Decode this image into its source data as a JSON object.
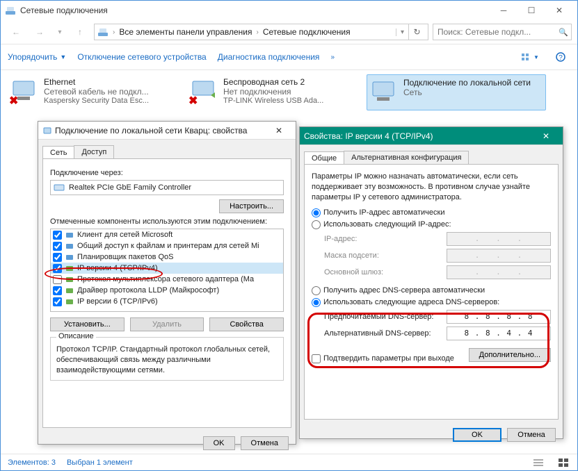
{
  "window": {
    "title": "Сетевые подключения",
    "breadcrumbs": [
      "Все элементы панели управления",
      "Сетевые подключения"
    ],
    "search_placeholder": "Поиск: Сетевые подкл..."
  },
  "toolbar": {
    "organize": "Упорядочить",
    "disable_device": "Отключение сетевого устройства",
    "diagnose": "Диагностика подключения"
  },
  "connections": [
    {
      "name": "Ethernet",
      "status": "Сетевой кабель не подкл...",
      "adapter": "Kaspersky Security Data Esc...",
      "err": true
    },
    {
      "name": "Беспроводная сеть 2",
      "status": "Нет подключения",
      "adapter": "TP-LINK Wireless USB Ada...",
      "err": true
    },
    {
      "name": "Подключение по локальной сети",
      "status": "Сеть",
      "adapter": "",
      "err": false,
      "selected": true
    }
  ],
  "statusbar": {
    "count": "Элементов: 3",
    "selected": "Выбран 1 элемент"
  },
  "props_dialog": {
    "title": "Подключение по локальной сети Кварц: свойства",
    "tabs": [
      "Сеть",
      "Доступ"
    ],
    "connect_via_label": "Подключение через:",
    "adapter_name": "Realtek PCIe GbE Family Controller",
    "configure_btn": "Настроить...",
    "components_label": "Отмеченные компоненты используются этим подключением:",
    "components": [
      {
        "name": "Клиент для сетей Microsoft",
        "checked": true,
        "icon": "client"
      },
      {
        "name": "Общий доступ к файлам и принтерам для сетей Mi",
        "checked": true,
        "icon": "share"
      },
      {
        "name": "Планировщик пакетов QoS",
        "checked": true,
        "icon": "qos"
      },
      {
        "name": "IP версии 4 (TCP/IPv4)",
        "checked": true,
        "icon": "proto",
        "selected": true
      },
      {
        "name": "Протокол мультиплексора сетевого адаптера (Ма",
        "checked": false,
        "icon": "proto"
      },
      {
        "name": "Драйвер протокола LLDP (Майкрософт)",
        "checked": true,
        "icon": "proto"
      },
      {
        "name": "IP версии 6 (TCP/IPv6)",
        "checked": true,
        "icon": "proto"
      }
    ],
    "btn_install": "Установить...",
    "btn_remove": "Удалить",
    "btn_props": "Свойства",
    "desc_label": "Описание",
    "desc_text": "Протокол TCP/IP. Стандартный протокол глобальных сетей, обеспечивающий связь между различными взаимодействующими сетями.",
    "btn_ok": "OK",
    "btn_cancel": "Отмена"
  },
  "ipv4_dialog": {
    "title": "Свойства: IP версии 4 (TCP/IPv4)",
    "tabs": [
      "Общие",
      "Альтернативная конфигурация"
    ],
    "intro": "Параметры IP можно назначать автоматически, если сеть поддерживает эту возможность. В противном случае узнайте параметры IP у сетевого администратора.",
    "radio_auto_ip": "Получить IP-адрес автоматически",
    "radio_manual_ip": "Использовать следующий IP-адрес:",
    "ip_addr_label": "IP-адрес:",
    "mask_label": "Маска подсети:",
    "gateway_label": "Основной шлюз:",
    "radio_auto_dns": "Получить адрес DNS-сервера автоматически",
    "radio_manual_dns": "Использовать следующие адреса DNS-серверов:",
    "pref_dns_label": "Предпочитаемый DNS-сервер:",
    "alt_dns_label": "Альтернативный DNS-сервер:",
    "pref_dns_value": "8 . 8 . 8 . 8",
    "alt_dns_value": "8 . 8 . 4 . 4",
    "confirm_exit": "Подтвердить параметры при выходе",
    "btn_advanced": "Дополнительно...",
    "btn_ok": "OK",
    "btn_cancel": "Отмена"
  }
}
